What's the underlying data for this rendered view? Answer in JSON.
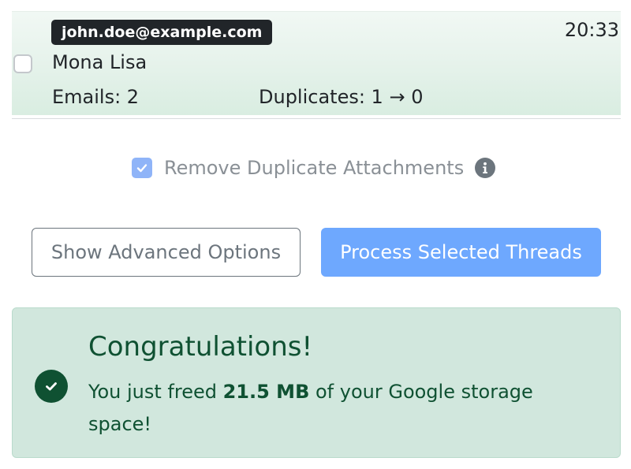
{
  "thread": {
    "email": "john.doe@example.com",
    "time": "20:33",
    "subject": "Mona Lisa",
    "emails_text": "Emails: 2",
    "duplicates_text": "Duplicates: 1 → 0",
    "checked": false
  },
  "options": {
    "remove_duplicates_label": "Remove Duplicate Attachments",
    "remove_duplicates_checked": true
  },
  "buttons": {
    "advanced_label": "Show Advanced Options",
    "process_label": "Process Selected Threads"
  },
  "alert": {
    "heading": "Congratulations!",
    "text_before": "You just freed ",
    "freed_amount": "21.5 MB",
    "text_after": " of your Google storage space!"
  },
  "colors": {
    "primary_light": "#6ea8fe",
    "success_text": "#0f5132",
    "success_bg": "#d1e7dd",
    "badge_bg": "#212529"
  },
  "icons": {
    "check": "check-icon",
    "info": "info-icon",
    "success": "check-circle-icon"
  }
}
